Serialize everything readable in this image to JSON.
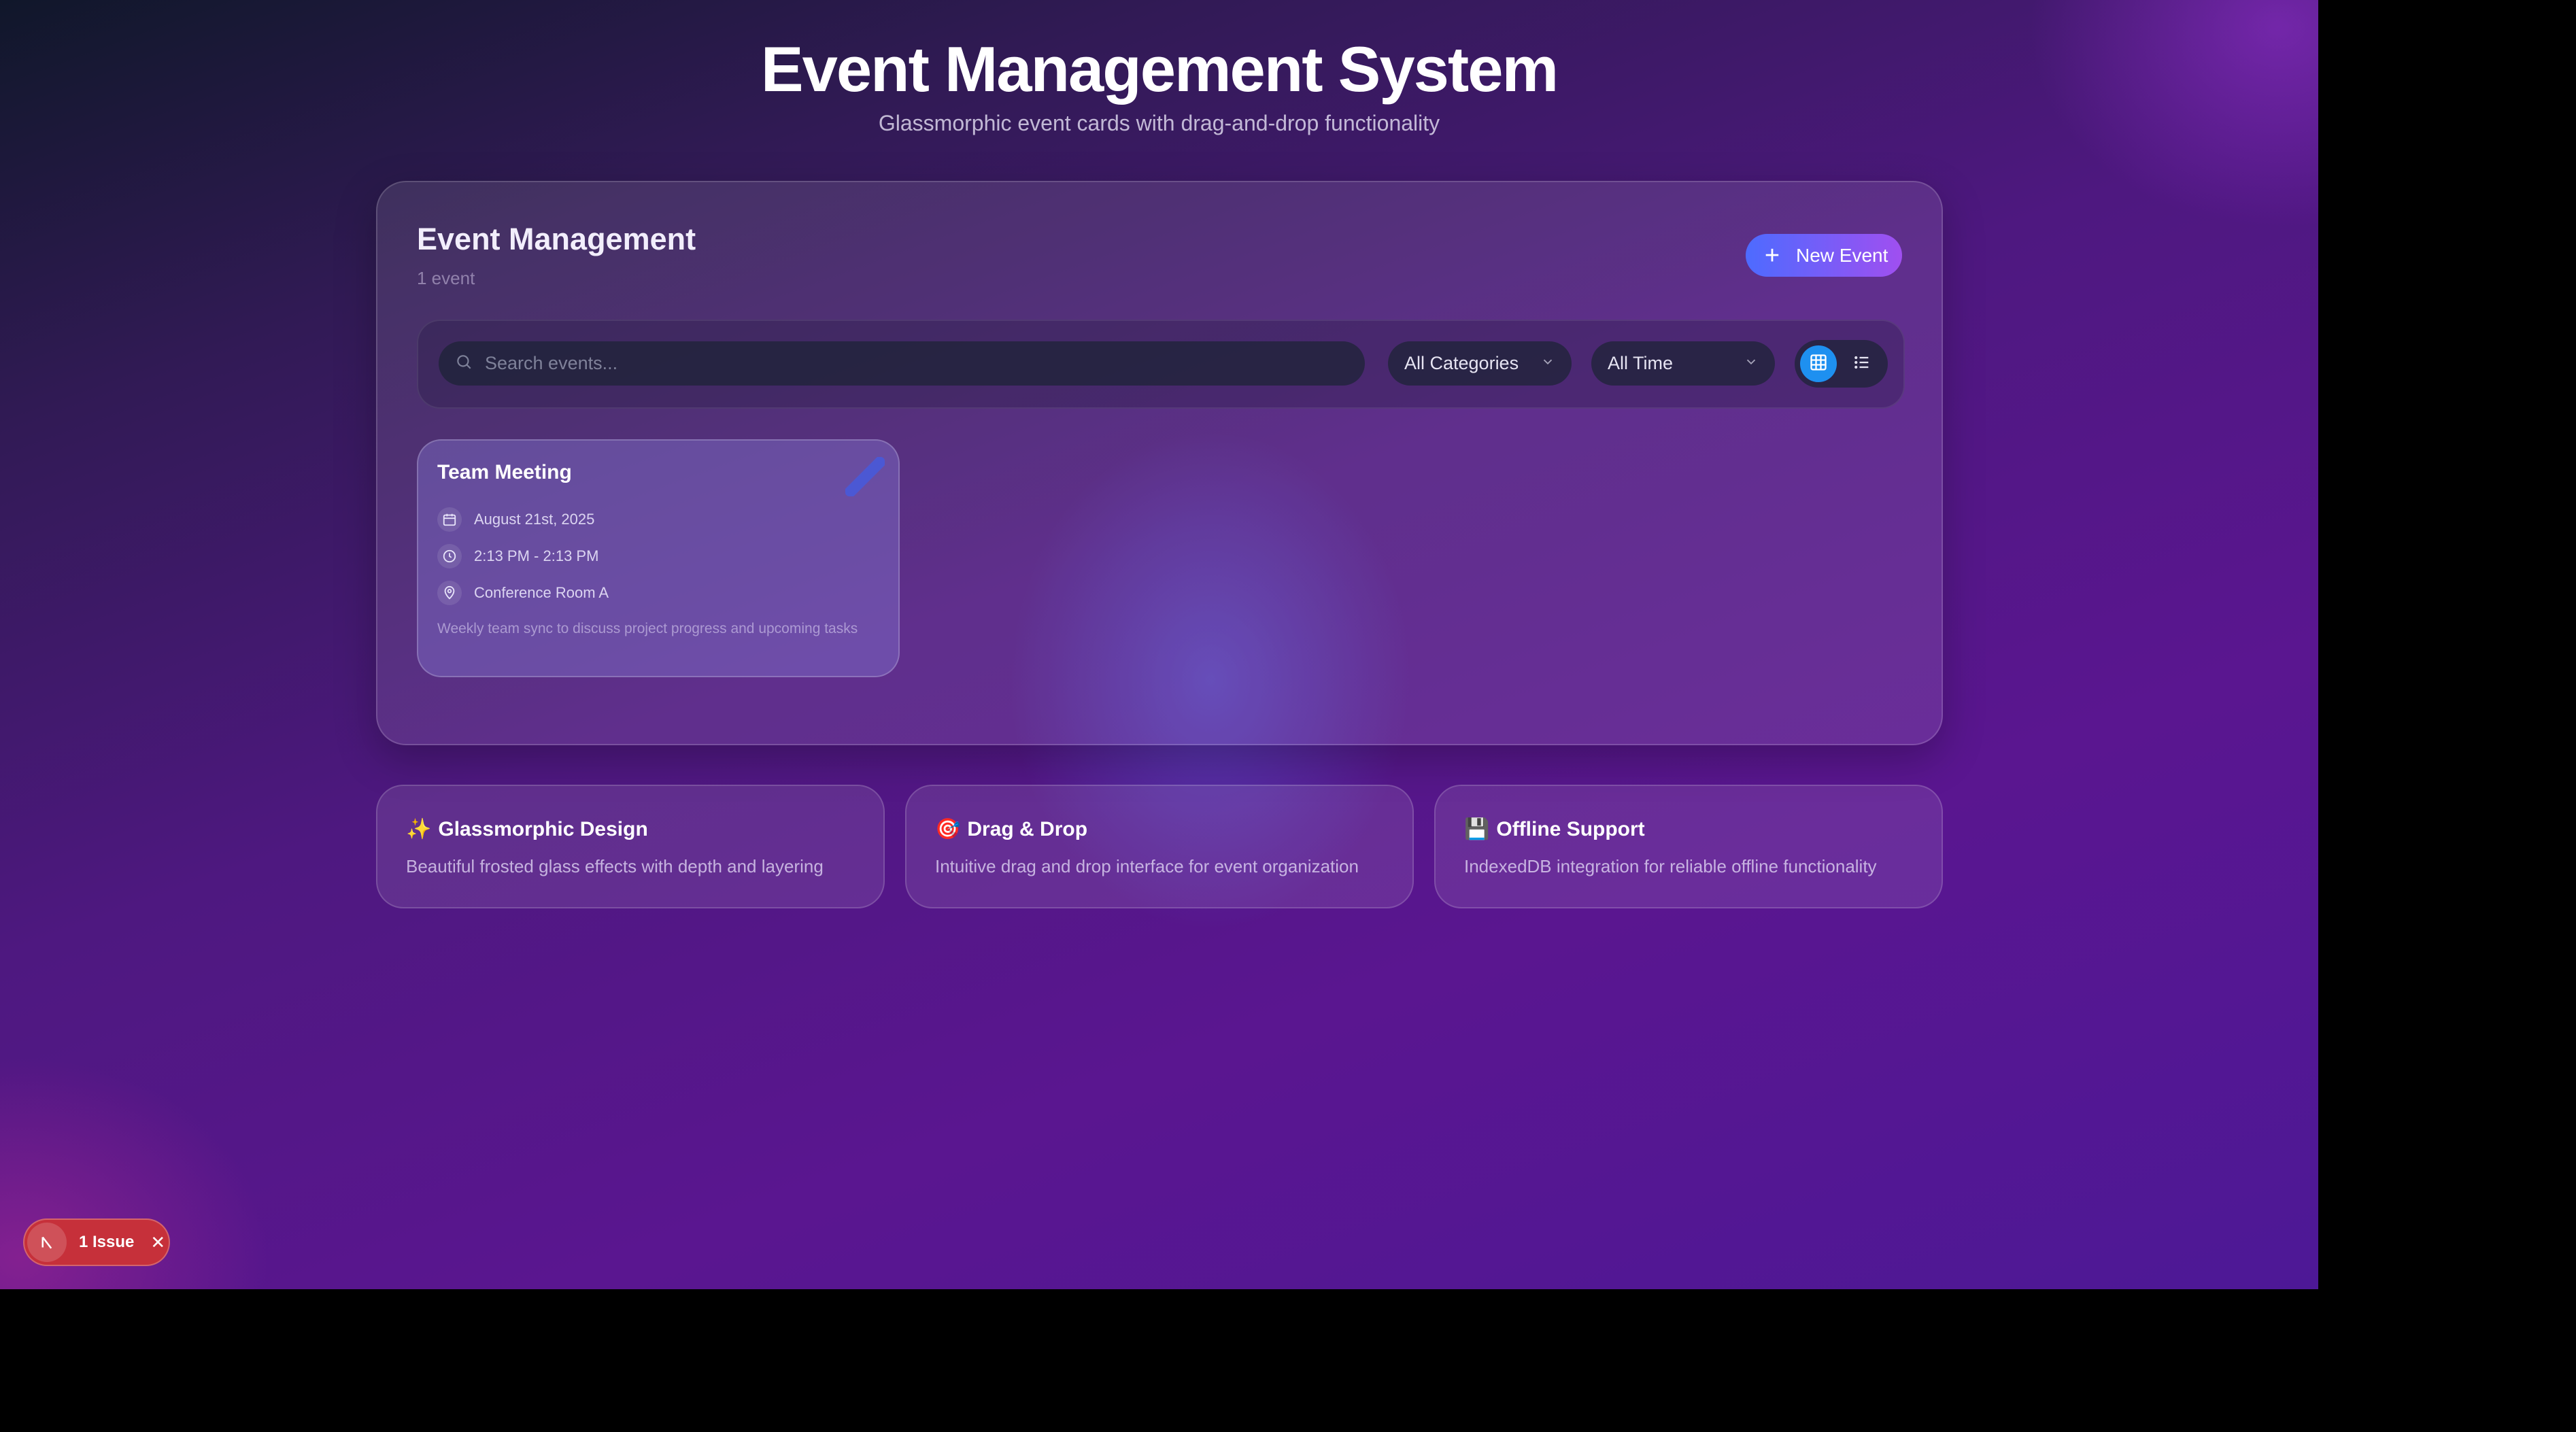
{
  "header": {
    "title": "Event Management System",
    "subtitle": "Glassmorphic event cards with drag-and-drop functionality"
  },
  "panel": {
    "title": "Event Management",
    "count": "1 event",
    "new_event_label": "New Event",
    "new_event_icon": "plus-icon"
  },
  "filters": {
    "search_placeholder": "Search events...",
    "search_value": "",
    "category": "All Categories",
    "time": "All Time",
    "view_mode": "grid"
  },
  "events": [
    {
      "title": "Team Meeting",
      "date": "August 21st, 2025",
      "time": "2:13 PM - 2:13 PM",
      "location": "Conference Room A",
      "description": "Weekly team sync to discuss project progress and upcoming tasks"
    }
  ],
  "features": [
    {
      "icon": "✨",
      "title": "Glassmorphic Design",
      "description": "Beautiful frosted glass effects with depth and layering"
    },
    {
      "icon": "🎯",
      "title": "Drag & Drop",
      "description": "Intuitive drag and drop interface for event organization"
    },
    {
      "icon": "💾",
      "title": "Offline Support",
      "description": "IndexedDB integration for reliable offline functionality"
    }
  ],
  "issue_badge": {
    "label": "1 Issue"
  },
  "colors": {
    "accent_start": "#4d6bff",
    "accent_end": "#a04ff0",
    "toggle_active": "#1e90f0",
    "issue_red": "#c6303a"
  }
}
